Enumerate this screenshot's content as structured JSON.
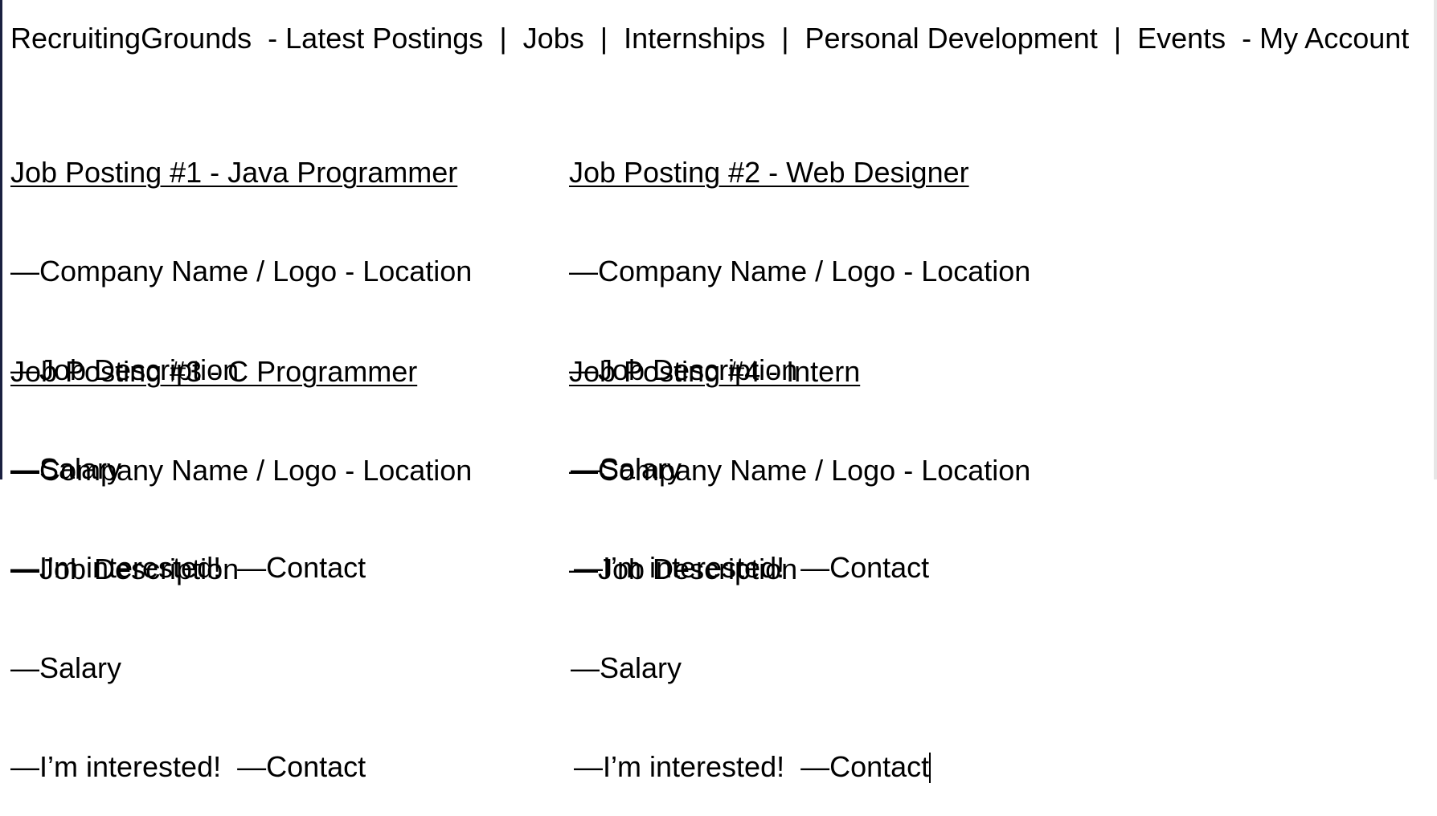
{
  "nav": {
    "brand": "RecruitingGrounds",
    "sep_dash": "  - ",
    "items": [
      "Latest Postings",
      "Jobs",
      "Internships",
      "Personal Development",
      "Events"
    ],
    "pipe": "  |  ",
    "account_dash": "  - ",
    "account": "My Account"
  },
  "postings": [
    {
      "title": "Job Posting #1 - Java Programmer",
      "company": "—Company Name / Logo - Location",
      "description": "—Job Description",
      "salary": "—Salary",
      "interested": "—I’m interested!",
      "contact": "—Contact"
    },
    {
      "title": "Job Posting #2 - Web Designer",
      "company": "—Company Name / Logo - Location",
      "description": "—Job Description",
      "salary": "—Salary",
      "interested": "—I’m interested!",
      "contact": "—Contact"
    },
    {
      "title": "Job Posting #3 - C Programmer",
      "company": "—Company Name / Logo - Location",
      "description": "—Job Description",
      "salary": "—Salary",
      "interested": "—I’m interested!",
      "contact": "—Contact"
    },
    {
      "title": "Job Posting #4 - Intern",
      "company": "—Company Name / Logo - Location",
      "description": "—Job Description",
      "salary": "—Salary",
      "interested": "—I’m interested!",
      "contact": "—Contact"
    }
  ]
}
